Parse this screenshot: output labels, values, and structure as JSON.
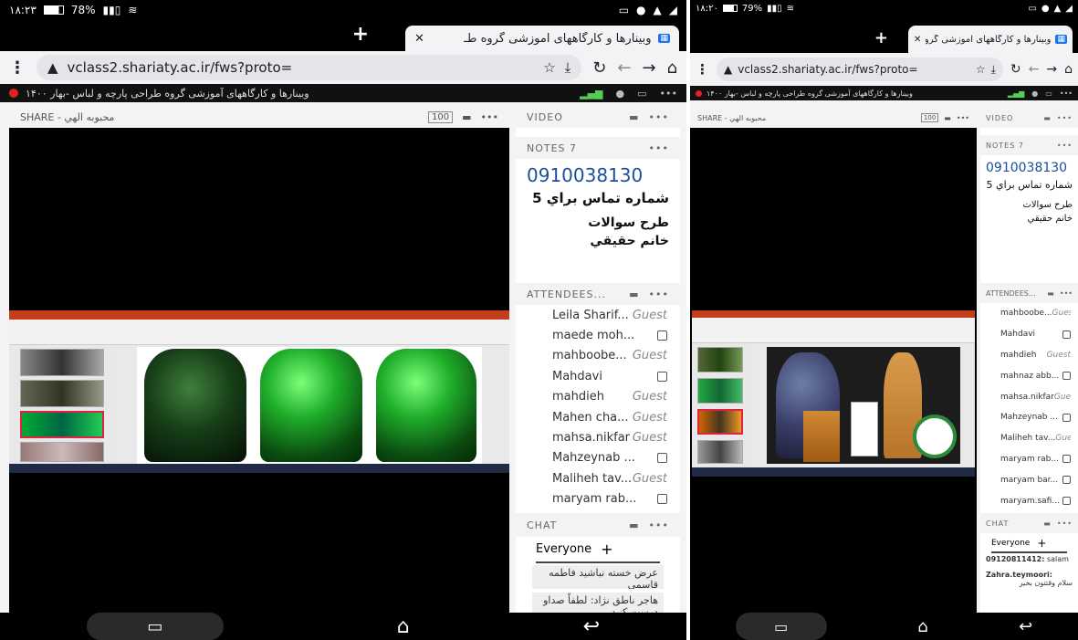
{
  "left": {
    "status": {
      "time": "۱۸:۲۳",
      "battery": "78%"
    },
    "tab": {
      "title": "وبینارها و کارگاههای آموزشی گروه طـ",
      "new_tab": "+",
      "close": "✕"
    },
    "url": "vclass2.shariaty.ac.ir/fws?proto=",
    "banner": "وبینارها و کارگاههای آموزشی گروه طراحی پارچه و لباس -بهار ۱۴۰۰",
    "share": {
      "title": "SHARE - محبوبه الهي",
      "zoom": "100"
    },
    "video_label": "VIDEO",
    "notes": {
      "title": "NOTES 7",
      "phone": "0910038130",
      "line1": "شماره تماس براي 5",
      "line2": "طرح سوالات",
      "line3": "خانم حقيقي"
    },
    "attendees_title": "ATTENDEES...",
    "attendees": [
      {
        "name": "Leila Sharif...",
        "role": "Guest",
        "icon": ""
      },
      {
        "name": "maede moh...",
        "role": "",
        "icon": "phone-icon"
      },
      {
        "name": "mahboobe...",
        "role": "Guest",
        "icon": ""
      },
      {
        "name": "Mahdavi",
        "role": "",
        "icon": "phone-icon"
      },
      {
        "name": "mahdieh",
        "role": "Guest",
        "icon": ""
      },
      {
        "name": "Mahen cha...",
        "role": "Guest",
        "icon": ""
      },
      {
        "name": "mahsa.nikfar",
        "role": "Guest",
        "icon": ""
      },
      {
        "name": "Mahzeynab ...",
        "role": "",
        "icon": "phone-icon"
      },
      {
        "name": "Maliheh tav...",
        "role": "Guest",
        "icon": ""
      },
      {
        "name": "maryam rab...",
        "role": "",
        "icon": "phone-icon"
      }
    ],
    "chat": {
      "title": "CHAT",
      "everyone": "Everyone",
      "msg1": "عرض خسته نباشید فاطمه قاسمي",
      "msg2": "هاجر ناطق نژاد: لطفاً صداو درست کنید"
    }
  },
  "right": {
    "status": {
      "time": "۱۸:۲۰",
      "battery": "79%"
    },
    "tab": {
      "title": "وبینارها و کارگاههای آموزشی گروه طـ",
      "new_tab": "+",
      "close": "✕"
    },
    "url": "vclass2.shariaty.ac.ir/fws?proto=",
    "banner": "وبینارها و کارگاههای آموزشی گروه طراحی پارچه و لباس -بهار ۱۴۰۰",
    "share": {
      "title": "SHARE - محبوبه الهي",
      "zoom": "100"
    },
    "video_label": "VIDEO",
    "notes": {
      "title": "NOTES 7",
      "phone": "0910038130",
      "line1": "شماره تماس براي 5",
      "line2": "طرح سوالات",
      "line3": "خانم حقيقي"
    },
    "attendees_title": "ATTENDEES...",
    "attendees": [
      {
        "name": "mahboobe...",
        "role": "Guest",
        "icon": ""
      },
      {
        "name": "Mahdavi",
        "role": "",
        "icon": "phone-icon"
      },
      {
        "name": "mahdieh",
        "role": "Guest",
        "icon": ""
      },
      {
        "name": "mahnaz abb...",
        "role": "",
        "icon": "phone-icon"
      },
      {
        "name": "mahsa.nikfar",
        "role": "Guest",
        "icon": ""
      },
      {
        "name": "Mahzeynab ...",
        "role": "",
        "icon": "phone-icon"
      },
      {
        "name": "Maliheh tav...",
        "role": "Guest",
        "icon": ""
      },
      {
        "name": "maryam rab...",
        "role": "",
        "icon": "phone-icon"
      },
      {
        "name": "maryam bar...",
        "role": "",
        "icon": "phone-icon"
      },
      {
        "name": "maryam.safi...",
        "role": "",
        "icon": "phone-icon"
      }
    ],
    "chat": {
      "title": "CHAT",
      "everyone": "Everyone",
      "msg1_sender": "09120811412:",
      "msg1_text": "salam",
      "msg2_sender": "Zahra.teymoori:",
      "msg2_text": "سلام وقتتون بخير"
    }
  },
  "colors": {
    "accent": "#1a4f9c",
    "record": "#e0241b",
    "ppt_ribbon": "#c43e1c"
  }
}
